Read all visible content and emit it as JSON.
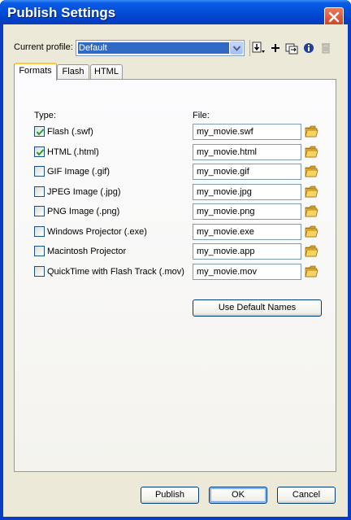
{
  "window": {
    "title": "Publish Settings",
    "close_icon": "close-icon"
  },
  "profile": {
    "label": "Current profile:",
    "selected": "Default",
    "tools": [
      "import-export-icon",
      "add-profile-icon",
      "duplicate-profile-icon",
      "profile-properties-icon",
      "delete-profile-icon"
    ]
  },
  "tabs": [
    {
      "label": "Formats",
      "active": true
    },
    {
      "label": "Flash",
      "active": false
    },
    {
      "label": "HTML",
      "active": false
    }
  ],
  "formats": {
    "type_header": "Type:",
    "file_header": "File:",
    "rows": [
      {
        "label": "Flash  (.swf)",
        "checked": true,
        "file": "my_movie.swf"
      },
      {
        "label": "HTML (.html)",
        "checked": true,
        "file": "my_movie.html"
      },
      {
        "label": "GIF Image (.gif)",
        "checked": false,
        "file": "my_movie.gif"
      },
      {
        "label": "JPEG Image (.jpg)",
        "checked": false,
        "file": "my_movie.jpg"
      },
      {
        "label": "PNG Image (.png)",
        "checked": false,
        "file": "my_movie.png"
      },
      {
        "label": "Windows Projector (.exe)",
        "checked": false,
        "file": "my_movie.exe"
      },
      {
        "label": "Macintosh Projector",
        "checked": false,
        "file": "my_movie.app"
      },
      {
        "label": "QuickTime with Flash Track (.mov)",
        "checked": false,
        "file": "my_movie.mov"
      }
    ],
    "default_names_label": "Use Default Names"
  },
  "buttons": {
    "publish": "Publish",
    "ok": "OK",
    "cancel": "Cancel"
  },
  "colors": {
    "titlebar": "#0451db",
    "selection": "#316ac5",
    "folder": "#f3c23c"
  }
}
